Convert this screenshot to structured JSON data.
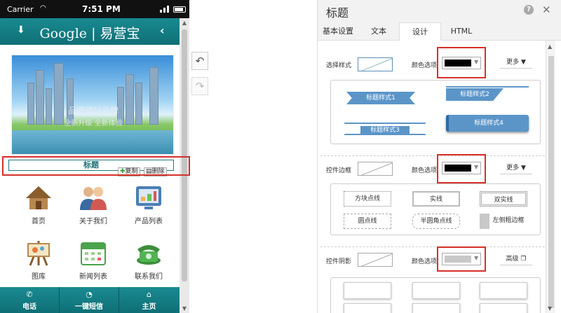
{
  "statusbar": {
    "carrier": "Carrier",
    "time": "7:51 PM"
  },
  "app": {
    "brand": "Google | 易营宝",
    "banner_line1": "品牌建站品牌",
    "banner_line2": "全新升级 全新体验",
    "title_text": "标题",
    "copy_label": "复制",
    "delete_label": "删除",
    "nav": [
      {
        "label": "首页",
        "icon": "house-icon"
      },
      {
        "label": "关于我们",
        "icon": "people-icon"
      },
      {
        "label": "产品列表",
        "icon": "screen-icon"
      },
      {
        "label": "图库",
        "icon": "easel-icon"
      },
      {
        "label": "新闻列表",
        "icon": "calendar-icon"
      },
      {
        "label": "联系我们",
        "icon": "phone-icon"
      }
    ],
    "tabbar": [
      {
        "label": "电话",
        "icon": "phone-icon"
      },
      {
        "label": "一键短信",
        "icon": "chat-icon"
      },
      {
        "label": "主页",
        "icon": "home-icon"
      }
    ]
  },
  "panel": {
    "title": "标题",
    "tabs": [
      "基本设置",
      "文本",
      "设计",
      "HTML"
    ],
    "active_tab": "设计",
    "style_row": {
      "label": "选择样式",
      "color_label": "颜色选项",
      "color": "#000000",
      "more": "更多"
    },
    "title_styles": [
      "标题样式1",
      "标题样式2",
      "标题样式3",
      "标题样式4"
    ],
    "border_row": {
      "label": "控件边框",
      "color_label": "颜色选项",
      "color": "#000000",
      "more": "更多"
    },
    "border_styles": [
      "方块点线",
      "实线",
      "双实线",
      "圆点线",
      "半圆角点线",
      "左侧粗边框"
    ],
    "shadow_row": {
      "label": "控件阴影",
      "color_label": "颜色选项",
      "color": "#c8c8c8",
      "more": "高级"
    }
  },
  "colors": {
    "teal": "#137d84",
    "red": "#d6302a",
    "blue": "#5b95c8"
  }
}
